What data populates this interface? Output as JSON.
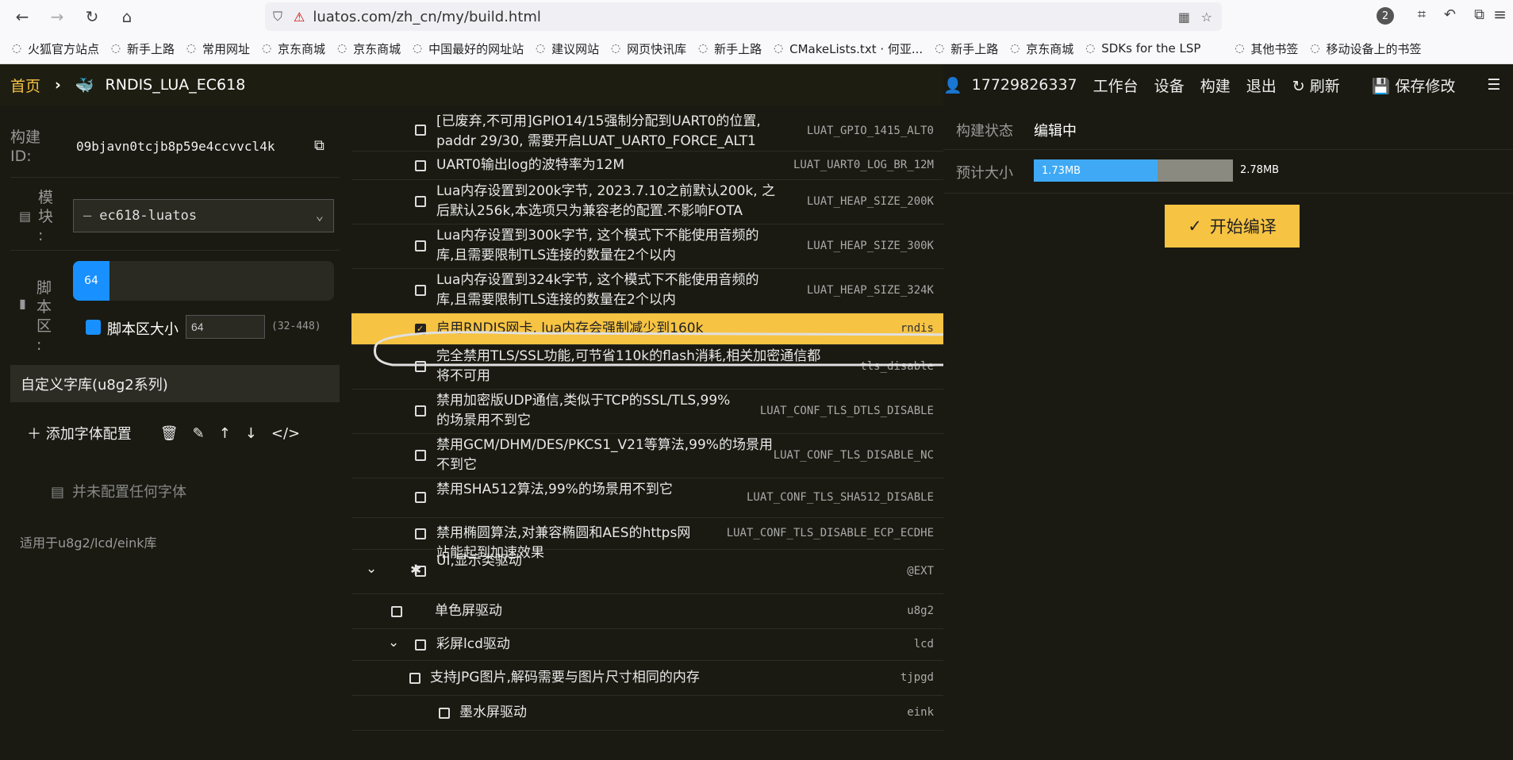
{
  "browser": {
    "url": "luatos.com/zh_cn/my/build.html",
    "notifications_count": "2",
    "bookmarks": [
      "火狐官方站点",
      "新手上路",
      "常用网址",
      "京东商城",
      "京东商城",
      "中国最好的网址站",
      "建议网站",
      "网页快讯库",
      "新手上路",
      "CMakeLists.txt · 何亚...",
      "新手上路",
      "京东商城",
      "SDKs for the LSP",
      "其他书签",
      "移动设备上的书签"
    ]
  },
  "header": {
    "home": "首页",
    "project": "RNDIS_LUA_EC618",
    "user": "17729826337",
    "links": [
      "工作台",
      "设备",
      "构建",
      "退出"
    ],
    "refresh": "刷新",
    "save": "保存修改"
  },
  "left": {
    "build_id_label": "构建ID:",
    "build_id": "09bjavn0tcjb8p59e4ccvvcl4k",
    "module_label": "模块:",
    "module_value": "ec618-luatos",
    "script_label": "脚本区:",
    "script_value": "64",
    "script_size_label": "脚本区大小",
    "script_size_input": "64",
    "script_size_range": "(32-448)",
    "font_section": "自定义字库(u8g2系列)",
    "add_font": "添加字体配置",
    "empty_fonts": "并未配置任何字体",
    "note": "适用于u8g2/lcd/eink库"
  },
  "list": [
    {
      "text1": "[已废弃,不可用]GPIO14/15强制分配到UART0的位置,",
      "text2": "paddr 29/30, 需要开启LUAT_UART0_FORCE_ALT1",
      "code": "LUAT_GPIO_1415_ALT0",
      "checked": false
    },
    {
      "text1": "UART0输出log的波特率为12M",
      "text2": "",
      "code": "LUAT_UART0_LOG_BR_12M",
      "checked": false
    },
    {
      "text1": "Lua内存设置到200k字节, 2023.7.10之前默认200k, 之",
      "text2": "后默认256k,本选项只为兼容老的配置.不影响FOTA",
      "code": "LUAT_HEAP_SIZE_200K",
      "checked": false
    },
    {
      "text1": "Lua内存设置到300k字节, 这个模式下不能使用音频的",
      "text2": "库,且需要限制TLS连接的数量在2个以内",
      "code": "LUAT_HEAP_SIZE_300K",
      "checked": false
    },
    {
      "text1": "Lua内存设置到324k字节, 这个模式下不能使用音频的",
      "text2": "库,且需要限制TLS连接的数量在2个以内",
      "code": "LUAT_HEAP_SIZE_324K",
      "checked": false
    },
    {
      "text1": "启用RNDIS网卡, lua内存会强制减少到160k",
      "text2": "",
      "code": "rndis",
      "checked": true
    },
    {
      "text1": "完全禁用TLS/SSL功能,可节省110k的flash消耗,相关加密通信都",
      "text2": "将不可用",
      "code": "tls_disable",
      "checked": false
    },
    {
      "text1": "禁用加密版UDP通信,类似于TCP的SSL/TLS,99%",
      "text2": "的场景用不到它",
      "code": "LUAT_CONF_TLS_DTLS_DISABLE",
      "checked": false
    },
    {
      "text1": "禁用GCM/DHM/DES/PKCS1_V21等算法,99%的场景用",
      "text2": "不到它",
      "code": "LUAT_CONF_TLS_DISABLE_NC",
      "checked": false
    },
    {
      "text1": "禁用SHA512算法,99%的场景用不到它",
      "text2": "",
      "code": "LUAT_CONF_TLS_SHA512_DISABLE",
      "checked": false
    },
    {
      "text1": "禁用椭圆算法,对兼容椭圆和AES的https网",
      "text2": "站能起到加速效果",
      "code": "LUAT_CONF_TLS_DISABLE_ECP_ECDHE",
      "checked": false
    },
    {
      "text1": "UI,显示类驱动",
      "text2": "",
      "code": "@EXT",
      "checked": false
    },
    {
      "text1": "单色屏驱动",
      "text2": "",
      "code": "u8g2",
      "checked": false
    },
    {
      "text1": "彩屏lcd驱动",
      "text2": "",
      "code": "lcd",
      "checked": false
    },
    {
      "text1": "支持JPG图片,解码需要与图片尺寸相同的内存",
      "text2": "",
      "code": "tjpgd",
      "checked": false
    },
    {
      "text1": "墨水屏驱动",
      "text2": "",
      "code": "eink",
      "checked": false
    }
  ],
  "right": {
    "status_label": "构建状态",
    "status_value": "编辑中",
    "size_label": "预计大小",
    "size_used": "1.73MB",
    "size_total": "2.78MB",
    "size_fraction": 0.62,
    "compile": "开始编译"
  }
}
